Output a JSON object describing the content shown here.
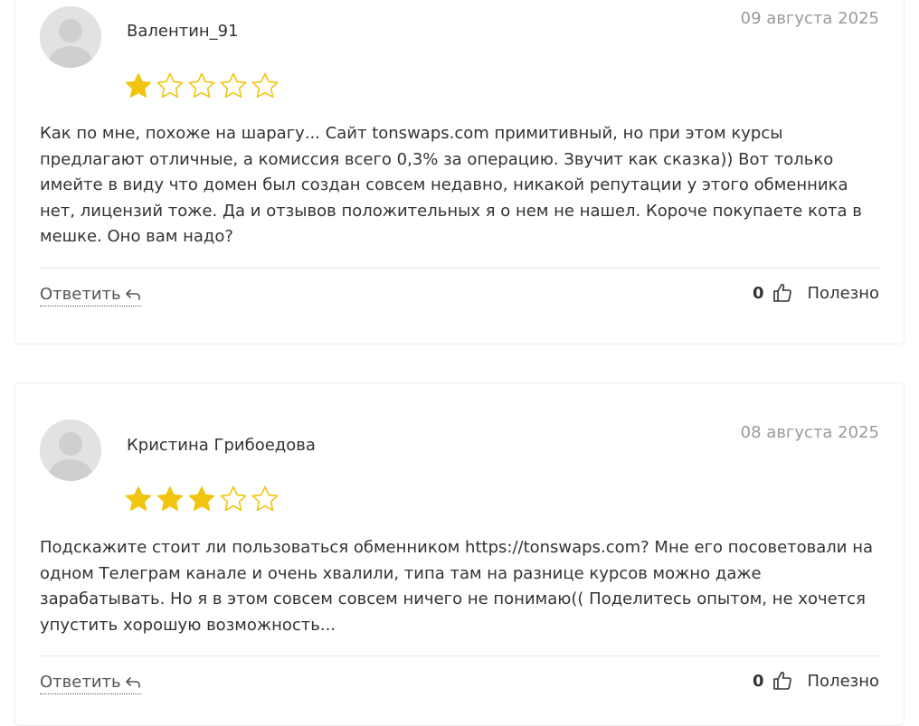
{
  "reviews": [
    {
      "author": "Валентин_91",
      "date": "09 августа 2025",
      "rating": 1,
      "max_rating": 5,
      "text": "Как по мне, похоже на шарагу... Сайт tonswaps.com примитивный, но при этом курсы предлагают отличные, а комиссия всего 0,3% за операцию. Звучит как сказка)) Вот только имейте в виду что домен был создан совсем недавно, никакой репутации у этого обменника нет, лицензий тоже. Да и отзывов положительных я о нем не нашел. Короче покупаете кота в мешке. Оно вам надо?",
      "reply_label": "Ответить",
      "likes": "0",
      "helpful_label": "Полезно"
    },
    {
      "author": "Кристина Грибоедова",
      "date": "08 августа 2025",
      "rating": 3,
      "max_rating": 5,
      "text": "Подскажите стоит ли пользоваться обменником https://tonswaps.com? Мне его посоветовали на одном Телеграм канале и очень хвалили, типа там на разнице курсов можно даже зарабатывать. Но я в этом совсем совсем ничего не понимаю(( Поделитесь опытом, не хочется упустить хорошую возможность...",
      "reply_label": "Ответить",
      "likes": "0",
      "helpful_label": "Полезно"
    }
  ],
  "colors": {
    "star_filled": "#f1c40f",
    "star_empty_stroke": "#f1c40f",
    "date": "#9a9a9a",
    "text": "#333333",
    "border": "#ececec",
    "avatar_bg": "#e2e2e2",
    "avatar_fg": "#cfcfcf"
  },
  "icons": {
    "avatar": "user-silhouette-icon",
    "star": "star-icon",
    "reply": "reply-arrow-icon",
    "like": "thumbs-up-icon"
  }
}
